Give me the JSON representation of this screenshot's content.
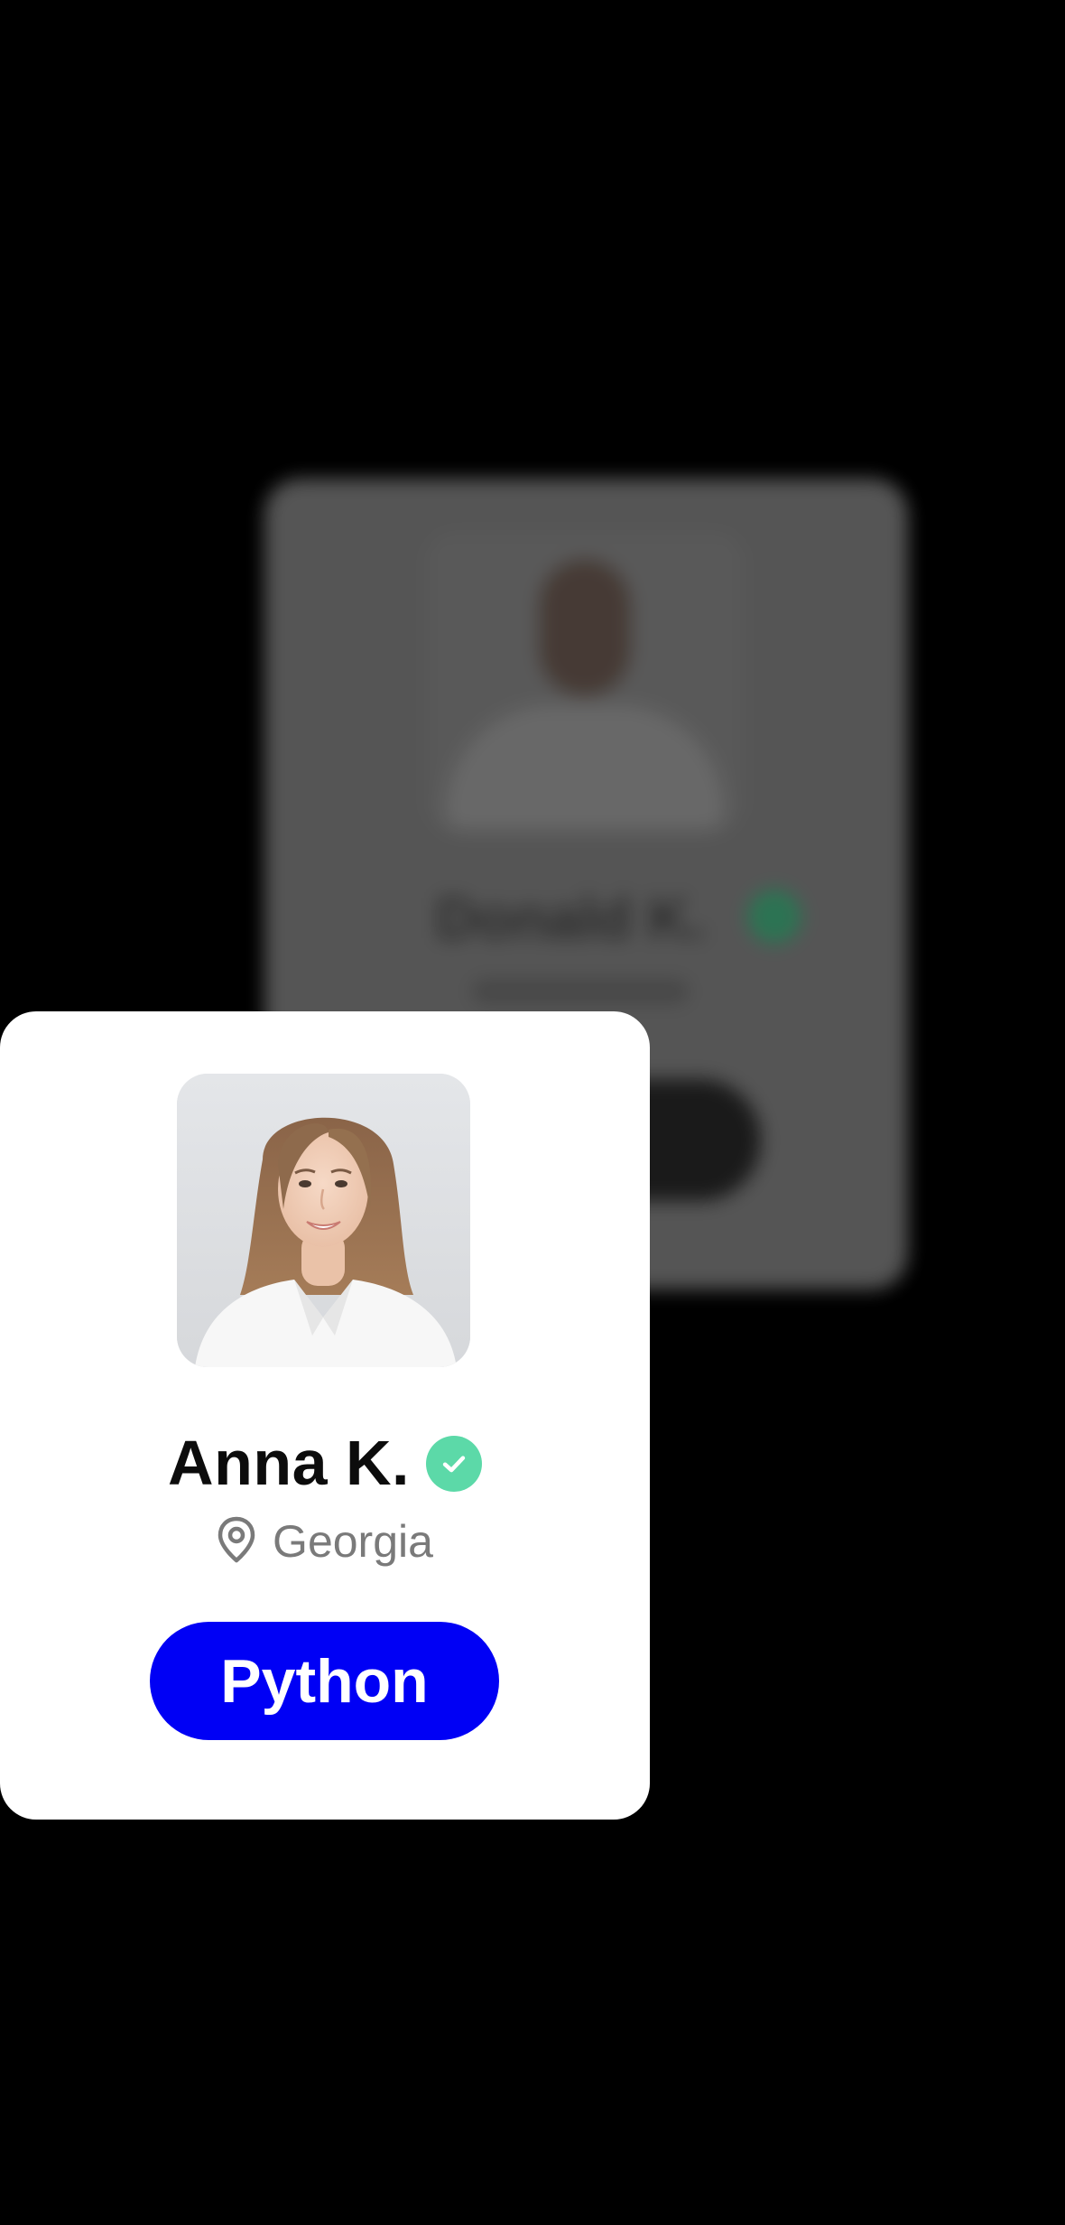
{
  "background_card": {
    "name": "Donald K.",
    "badge_color": "#2f7a58"
  },
  "profile_card": {
    "name": "Anna K.",
    "verified_icon": "check-circle-icon",
    "verified_color": "#5cd9a8",
    "location_icon": "map-pin-icon",
    "location": "Georgia",
    "tag_label": "Python",
    "tag_color": "#0000f5"
  }
}
